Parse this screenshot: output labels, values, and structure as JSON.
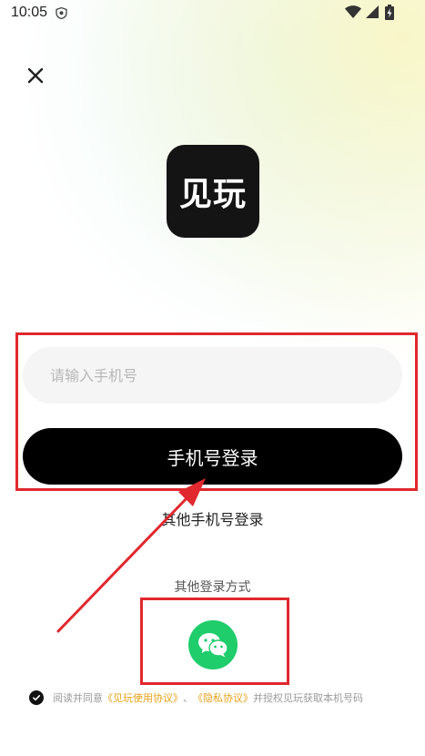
{
  "status_bar": {
    "time": "10:05"
  },
  "icons": {
    "close": "close-icon",
    "wechat": "wechat-icon",
    "checkbox": "check-icon"
  },
  "logo": {
    "text": "见玩"
  },
  "login": {
    "phone_placeholder": "请输入手机号",
    "login_button_label": "手机号登录",
    "other_phone_label": "其他手机号登录"
  },
  "other_methods": {
    "label": "其他登录方式"
  },
  "agreement": {
    "prefix": "阅读并同意",
    "user_agreement": "《见玩使用协议》",
    "separator": "、",
    "privacy_agreement": "《隐私协议》",
    "suffix": "并授权见玩获取本机号码"
  },
  "colors": {
    "wechat_green": "#1fcd6b",
    "link_orange": "#e6a21a",
    "annotation_red": "#e0282e",
    "button_black": "#000000"
  }
}
